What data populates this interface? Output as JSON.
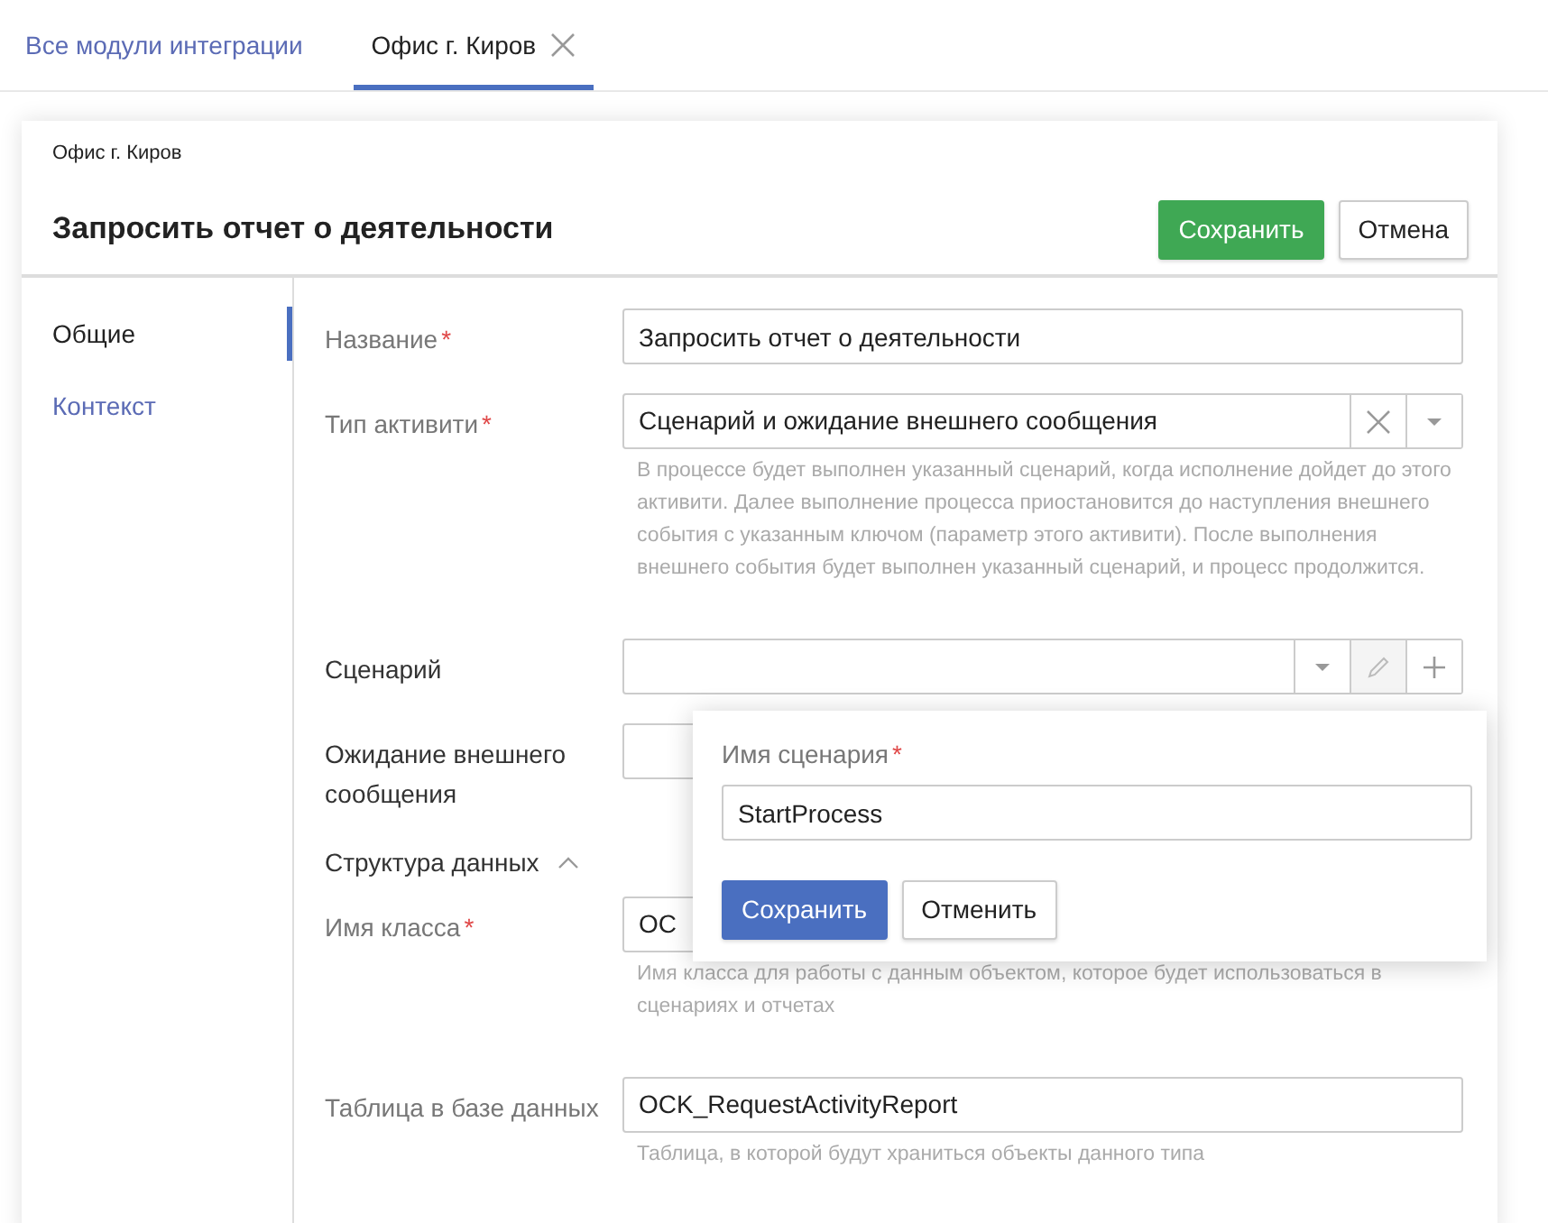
{
  "tabs": [
    {
      "label": "Все модули интеграции",
      "selected": false,
      "closable": false
    },
    {
      "label": "Офис г. Киров",
      "selected": true,
      "closable": true
    }
  ],
  "header": {
    "breadcrumb": "Офис г. Киров",
    "title": "Запросить отчет о деятельности",
    "buttons": [
      {
        "label": "Сохранить",
        "kind": "primary"
      },
      {
        "label": "Отмена",
        "kind": "secondary"
      }
    ]
  },
  "sidebar": {
    "items": [
      {
        "label": "Общие",
        "selected": true
      },
      {
        "label": "Контекст",
        "selected": false
      }
    ]
  },
  "form": {
    "items": [
      {
        "kind": "text",
        "label": "Название",
        "mark": "*",
        "value": "Запросить отчет о деятельности"
      },
      {
        "kind": "select",
        "label": "Тип активити",
        "mark": "*",
        "value": "Сценарий и ожидание внешнего сообщения",
        "help": "В процессе будет выполнен указанный сценарий, когда исполнение дойдет до этого активити. Далее выполнение процесса приостановится до наступления внешнего события с указанным ключом (параметр этого активити). После выполнения внешнего события будет выполнен указанный сценарий, и процесс продолжится."
      },
      {
        "kind": "lookup",
        "label": "Сценарий",
        "dark": true,
        "popover": {
          "label": "Имя сценария",
          "mark": "*",
          "value": "StartProcess",
          "buttons": [
            {
              "label": "Сохранить",
              "kind": "primary"
            },
            {
              "label": "Отменить",
              "kind": "secondary"
            }
          ]
        }
      },
      {
        "kind": "text",
        "label": "Ожидание внешнего сообщения",
        "dark": true
      },
      {
        "kind": "section",
        "label": "Структура данных",
        "expanded": true
      },
      {
        "kind": "text",
        "label": "Имя класса",
        "mark": "*",
        "value": "OC",
        "help": "Имя класса для работы с данным объектом, которое будет использоваться в сценариях и отчетах"
      },
      {
        "kind": "text",
        "label": "Таблица в базе данных",
        "value": "OCK_RequestActivityReport",
        "help": "Таблица, в которой будут храниться объекты данного типа"
      }
    ]
  }
}
